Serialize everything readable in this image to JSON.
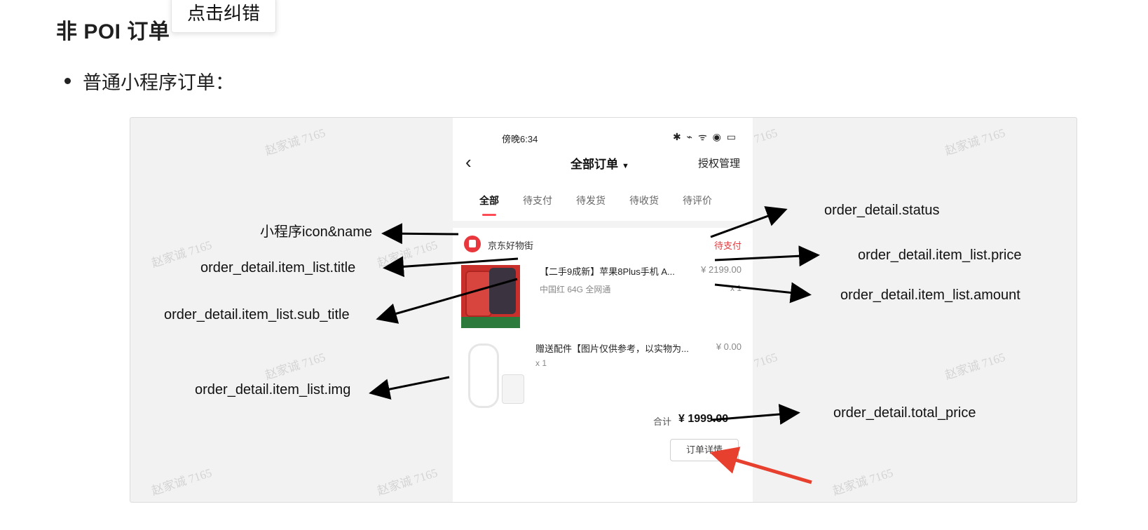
{
  "heading": "非 POI 订单",
  "tooltip": "点击纠错",
  "bullet": "普通小程序订单：",
  "watermark": "赵家诚 7165",
  "phone": {
    "status_time": "傍晚6:34",
    "nav_title": "全部订单",
    "nav_right": "授权管理",
    "tabs": [
      "全部",
      "待支付",
      "待发货",
      "待收货",
      "待评价"
    ],
    "active_tab": 0,
    "shop_name": "京东好物街",
    "order_status": "待支付",
    "item1": {
      "title": "【二手9成新】苹果8Plus手机 A...",
      "price": "¥ 2199.00",
      "sub_title": "中国红 64G 全网通",
      "qty": "x 1"
    },
    "item2": {
      "title": "赠送配件【图片仅供参考，以实物为...",
      "price": "¥ 0.00",
      "qty": "x 1"
    },
    "total_label": "合计",
    "total_value": "¥ 1999.00",
    "detail_button": "订单详情"
  },
  "annotations": {
    "icon_name": "小程序icon&name",
    "title": "order_detail.item_list.title",
    "sub_title": "order_detail.item_list.sub_title",
    "img": "order_detail.item_list.img",
    "status": "order_detail.status",
    "price": "order_detail.item_list.price",
    "amount": "order_detail.item_list.amount",
    "total_price": "order_detail.total_price"
  },
  "colors": {
    "accent_red": "#e8383d",
    "arrow_red": "#e8402f",
    "arrow_black": "#000000"
  }
}
